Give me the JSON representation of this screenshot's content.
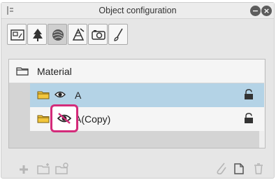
{
  "window": {
    "title": "Object configuration",
    "minimize_glyph": "−",
    "close_glyph": "×"
  },
  "tabs": [
    {
      "icon": "frame-border-icon"
    },
    {
      "icon": "tree-icon"
    },
    {
      "icon": "sphere-icon"
    },
    {
      "icon": "perspective-icon"
    },
    {
      "icon": "camera-icon"
    },
    {
      "icon": "brush-icon"
    }
  ],
  "tree": {
    "material": {
      "label": "Material"
    },
    "item_a": {
      "label": "A"
    },
    "item_copy": {
      "label": "A(Copy)"
    }
  },
  "footer": {
    "icons": [
      "add-icon",
      "new-folder-icon",
      "folder-duplicate-icon",
      "clip-icon",
      "duplicate-icon",
      "trash-icon"
    ]
  },
  "colors": {
    "highlight": "#d42b7a",
    "selected_row": "#b4d3e6",
    "folder": "#f2c63c"
  }
}
